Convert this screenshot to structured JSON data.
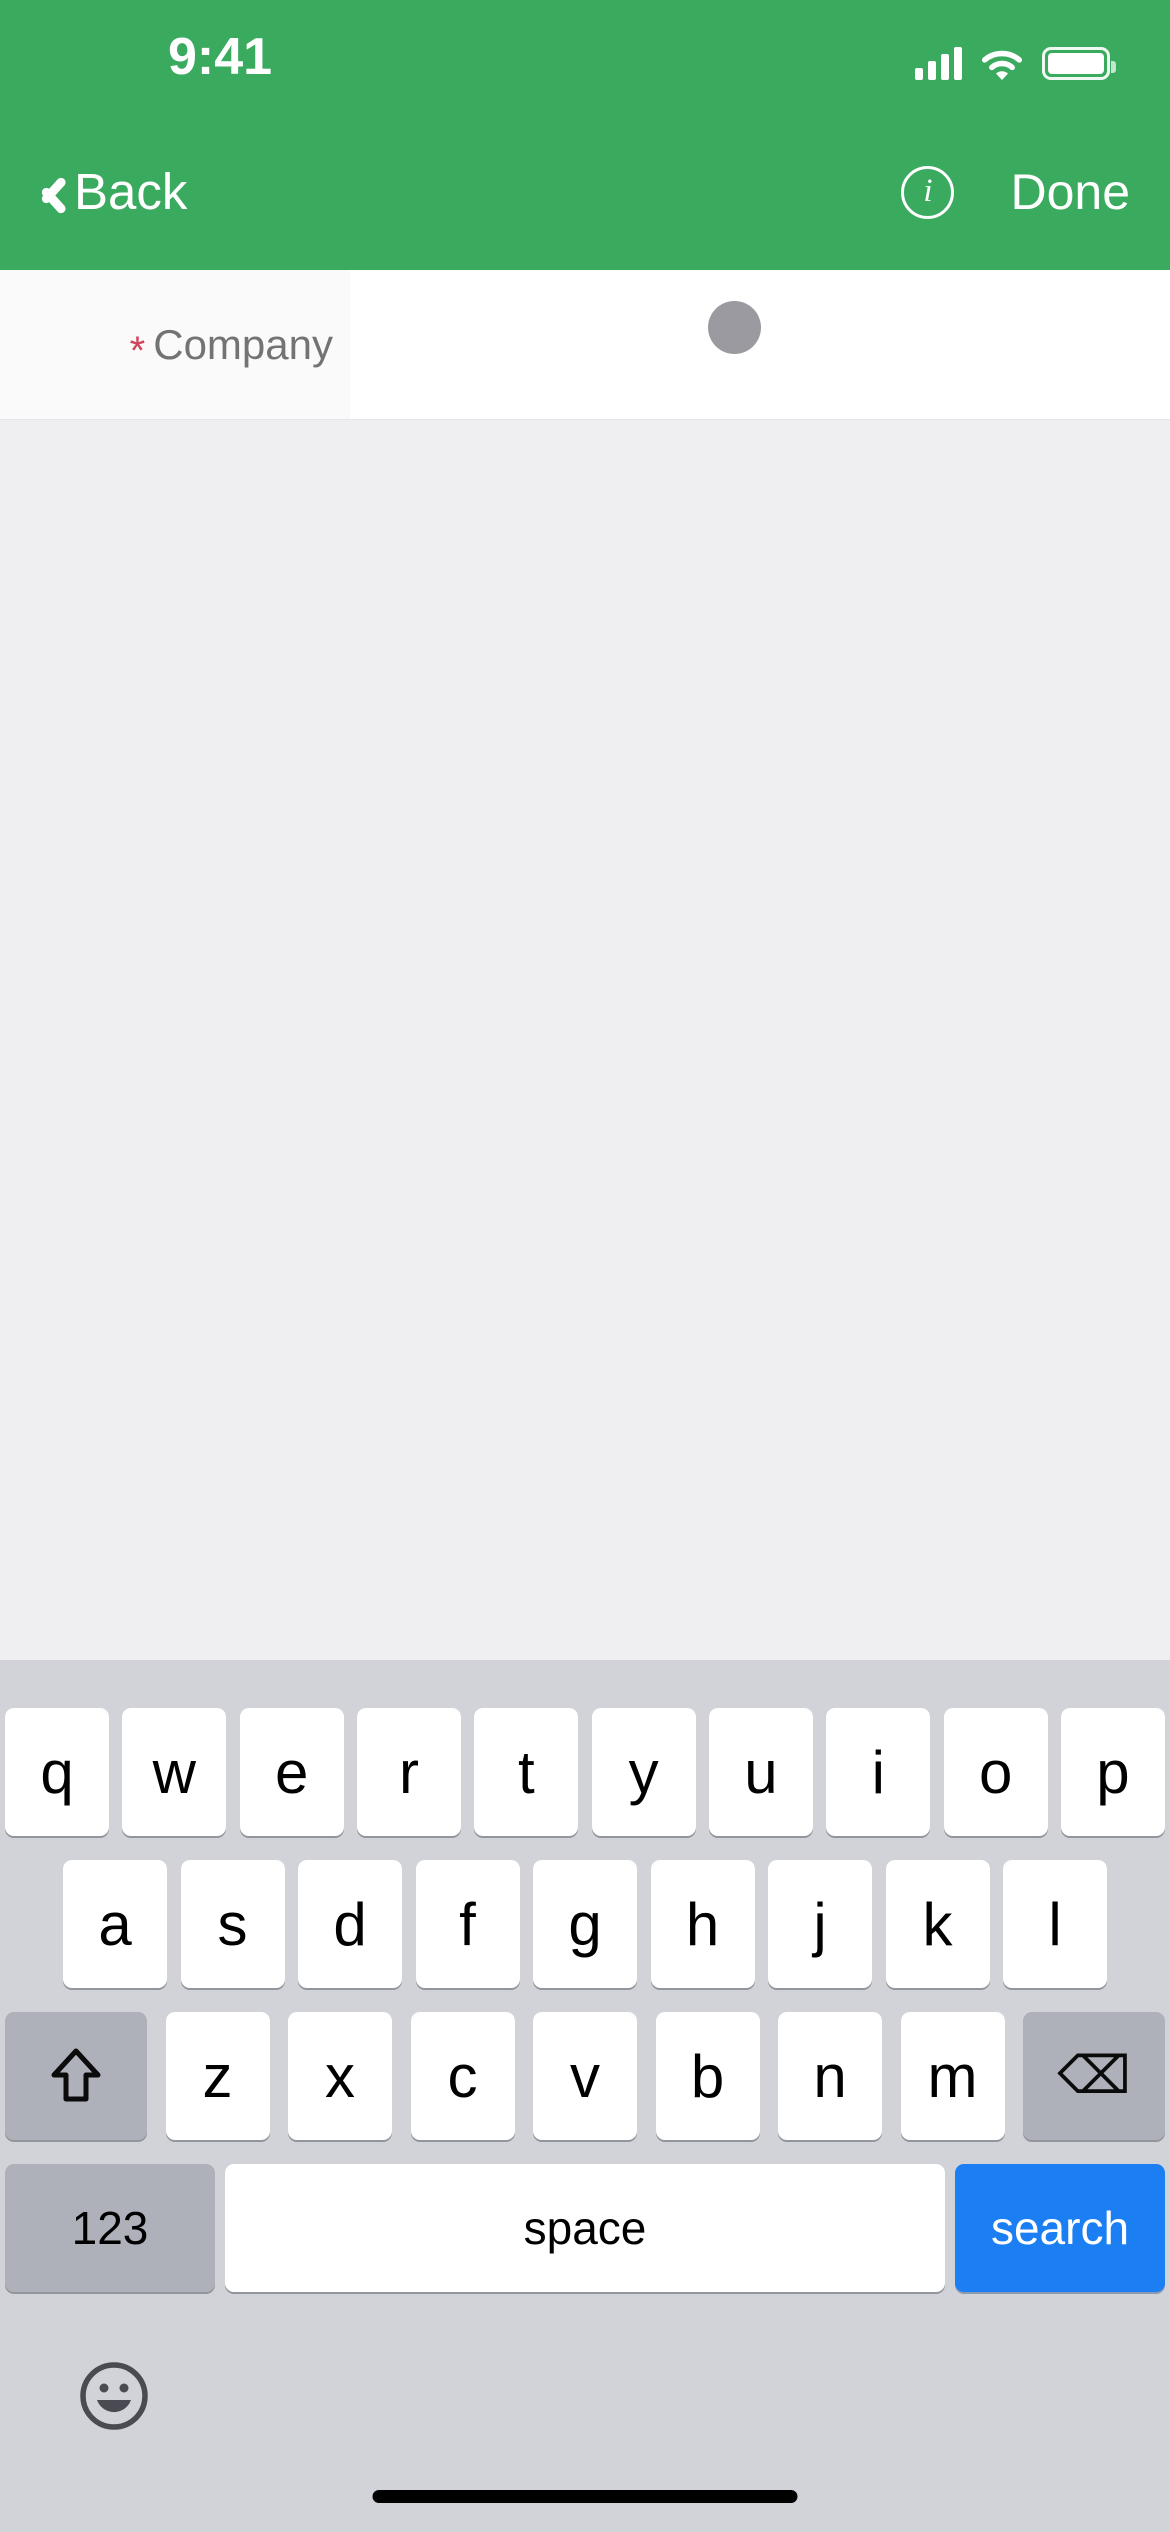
{
  "status_bar": {
    "time": "9:41",
    "signal_icon": "cellular-signal-icon",
    "wifi_icon": "wifi-icon",
    "battery_icon": "battery-full-icon"
  },
  "nav_bar": {
    "back_label": "Back",
    "back_icon": "chevron-left-icon",
    "info_icon": "info-circle-icon",
    "info_glyph": "i",
    "done_label": "Done",
    "background_color": "#3aaa5f"
  },
  "form": {
    "rows": [
      {
        "required_marker": "*",
        "label": "Company",
        "value": "",
        "loading_indicator": "loading-dot-icon"
      }
    ],
    "label_color": "#737373",
    "required_color": "#d0435b",
    "loading_dot_color": "#9a9aa0"
  },
  "content": {
    "background_color": "#efeef1"
  },
  "keyboard": {
    "background_color": "#d1d3d9",
    "row1": [
      "q",
      "w",
      "e",
      "r",
      "t",
      "y",
      "u",
      "i",
      "o",
      "p"
    ],
    "row2": [
      "a",
      "s",
      "d",
      "f",
      "g",
      "h",
      "j",
      "k",
      "l"
    ],
    "row3_letters": [
      "z",
      "x",
      "c",
      "v",
      "b",
      "n",
      "m"
    ],
    "shift_icon": "shift-arrow-icon",
    "backspace_icon": "backspace-delete-icon",
    "backspace_glyph": "⌫",
    "numeric_label": "123",
    "space_label": "space",
    "return_label": "search",
    "return_color": "#1c7ef3",
    "emoji_icon": "emoji-smiley-icon"
  },
  "home_indicator": {
    "icon": "home-indicator-bar"
  }
}
